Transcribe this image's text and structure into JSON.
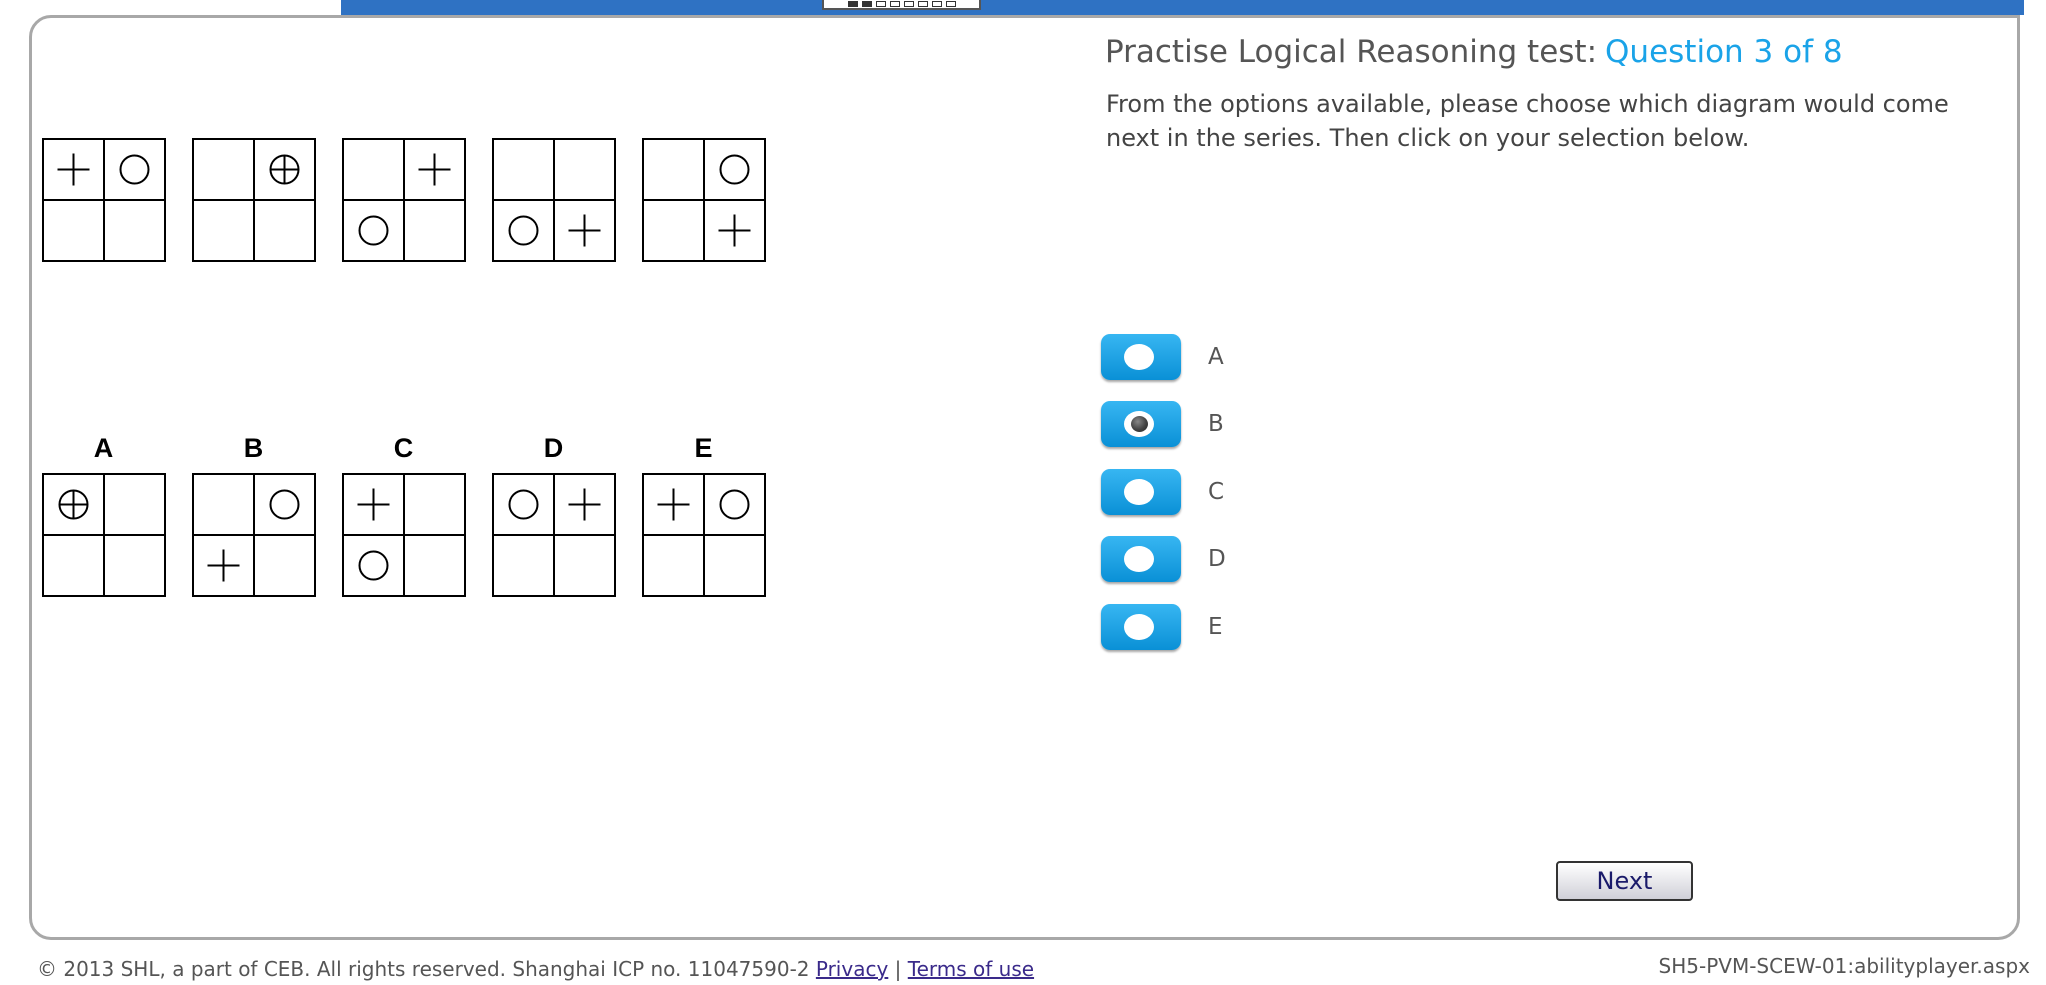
{
  "header": {
    "progress_total": 8,
    "progress_current": 3
  },
  "title": {
    "text": "Practise Logical Reasoning test:",
    "question": "Question 3 of 8"
  },
  "instructions": "From the options available, please choose which diagram would come next in the series. Then click on your selection below.",
  "sequence": [
    {
      "cells": [
        "plus",
        "circle",
        "",
        ""
      ]
    },
    {
      "cells": [
        "",
        "circle-plus",
        "",
        ""
      ]
    },
    {
      "cells": [
        "",
        "plus",
        "circle",
        ""
      ]
    },
    {
      "cells": [
        "",
        "",
        "circle",
        "plus"
      ]
    },
    {
      "cells": [
        "",
        "circle",
        "",
        "plus"
      ]
    }
  ],
  "answer_diagrams": [
    {
      "label": "A",
      "cells": [
        "circle-plus",
        "",
        "",
        ""
      ]
    },
    {
      "label": "B",
      "cells": [
        "",
        "circle",
        "plus",
        ""
      ]
    },
    {
      "label": "C",
      "cells": [
        "plus",
        "",
        "circle",
        ""
      ]
    },
    {
      "label": "D",
      "cells": [
        "circle",
        "plus",
        "",
        ""
      ]
    },
    {
      "label": "E",
      "cells": [
        "plus",
        "circle",
        "",
        ""
      ]
    }
  ],
  "options": [
    {
      "label": "A",
      "selected": false
    },
    {
      "label": "B",
      "selected": true
    },
    {
      "label": "C",
      "selected": false
    },
    {
      "label": "D",
      "selected": false
    },
    {
      "label": "E",
      "selected": false
    }
  ],
  "next_label": "Next",
  "footer": {
    "copyright": "© 2013 SHL, a part of CEB. All rights reserved. Shanghai ICP no. 11047590-2",
    "privacy": "Privacy",
    "separator": "|",
    "terms": "Terms of use",
    "page_id": "SH5-PVM-SCEW-01:abilityplayer.aspx"
  },
  "colors": {
    "accent": "#1aa3e8",
    "top_bar": "#2f72c3",
    "option_button": "#0a90d6"
  }
}
